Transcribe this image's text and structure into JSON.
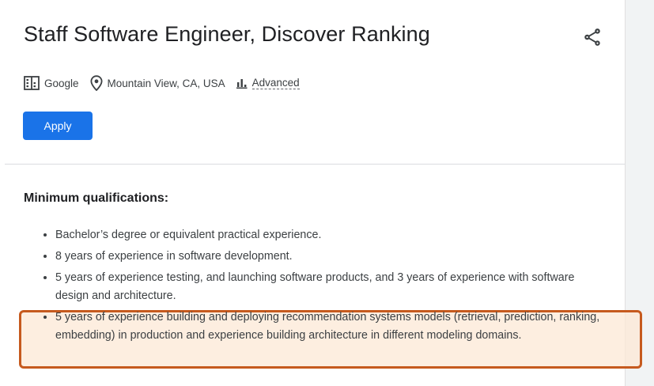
{
  "job": {
    "title": "Staff Software Engineer, Discover Ranking",
    "company": "Google",
    "location": "Mountain View, CA, USA",
    "level": "Advanced",
    "apply_label": "Apply"
  },
  "icons": {
    "share": "share-icon",
    "company": "building-icon",
    "location": "location-pin-icon",
    "level": "bar-chart-icon"
  },
  "qualifications": {
    "heading": "Minimum qualifications:",
    "items": [
      "Bachelor’s degree or equivalent practical experience.",
      "8 years of experience in software development.",
      "5 years of experience testing, and launching software products, and 3 years of experience with software design and architecture.",
      "5 years of experience building and deploying recommendation systems models (retrieval, prediction, ranking, embedding) in production and experience building architecture in different modeling domains."
    ],
    "highlighted_item_index": 3
  },
  "colors": {
    "apply_button": "#1a73e8",
    "highlight_border": "#c65a1e",
    "highlight_fill": "#fce8d5",
    "title_text": "#202124"
  }
}
